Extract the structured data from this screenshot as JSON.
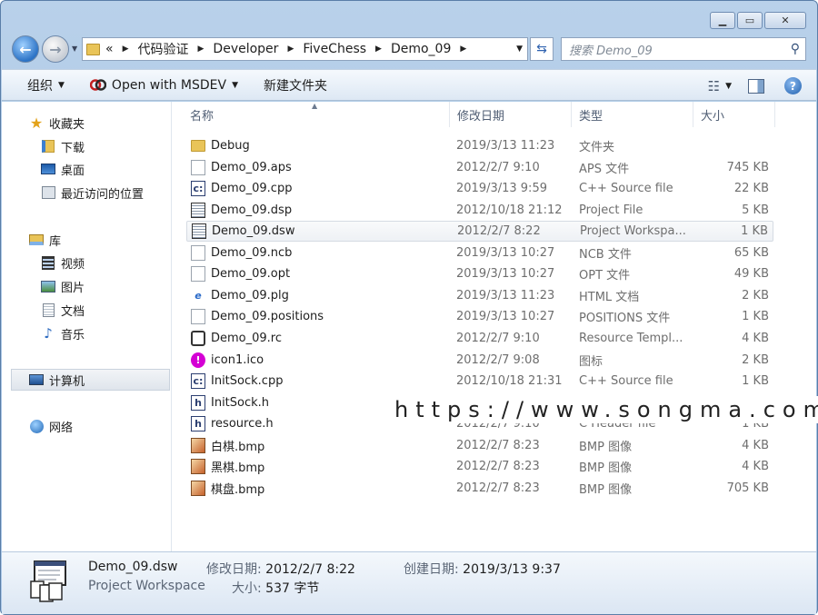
{
  "address": {
    "crumbs": [
      "«",
      "代码验证",
      "Developer",
      "FiveChess",
      "Demo_09"
    ],
    "search_placeholder": "搜索 Demo_09"
  },
  "toolbar": {
    "organize": "组织",
    "open_with": "Open with MSDEV",
    "new_folder": "新建文件夹"
  },
  "nav": {
    "favorites": "收藏夹",
    "downloads": "下载",
    "desktop": "桌面",
    "recent": "最近访问的位置",
    "libraries": "库",
    "videos": "视频",
    "pictures": "图片",
    "documents": "文档",
    "music": "音乐",
    "computer": "计算机",
    "network": "网络"
  },
  "columns": {
    "name": "名称",
    "date": "修改日期",
    "type": "类型",
    "size": "大小"
  },
  "files": [
    {
      "name": "Debug",
      "date": "2019/3/13 11:23",
      "type": "文件夹",
      "size": "",
      "icon": "folder-icon"
    },
    {
      "name": "Demo_09.aps",
      "date": "2012/2/7 9:10",
      "type": "APS 文件",
      "size": "745 KB",
      "icon": "file-icon"
    },
    {
      "name": "Demo_09.cpp",
      "date": "2019/3/13 9:59",
      "type": "C++ Source file",
      "size": "22 KB",
      "icon": "cpp-file-icon"
    },
    {
      "name": "Demo_09.dsp",
      "date": "2012/10/18 21:12",
      "type": "Project File",
      "size": "5 KB",
      "icon": "project-file-icon"
    },
    {
      "name": "Demo_09.dsw",
      "date": "2012/2/7 8:22",
      "type": "Project Workspa...",
      "size": "1 KB",
      "icon": "workspace-file-icon"
    },
    {
      "name": "Demo_09.ncb",
      "date": "2019/3/13 10:27",
      "type": "NCB 文件",
      "size": "65 KB",
      "icon": "file-icon"
    },
    {
      "name": "Demo_09.opt",
      "date": "2019/3/13 10:27",
      "type": "OPT 文件",
      "size": "49 KB",
      "icon": "file-icon"
    },
    {
      "name": "Demo_09.plg",
      "date": "2019/3/13 11:23",
      "type": "HTML 文档",
      "size": "2 KB",
      "icon": "html-file-icon"
    },
    {
      "name": "Demo_09.positions",
      "date": "2019/3/13 10:27",
      "type": "POSITIONS 文件",
      "size": "1 KB",
      "icon": "file-icon"
    },
    {
      "name": "Demo_09.rc",
      "date": "2012/2/7 9:10",
      "type": "Resource Templ...",
      "size": "4 KB",
      "icon": "resource-file-icon"
    },
    {
      "name": "icon1.ico",
      "date": "2012/2/7 9:08",
      "type": "图标",
      "size": "2 KB",
      "icon": "ico-file-icon"
    },
    {
      "name": "InitSock.cpp",
      "date": "2012/10/18 21:31",
      "type": "C++ Source file",
      "size": "1 KB",
      "icon": "cpp-file-icon"
    },
    {
      "name": "InitSock.h",
      "date": "2012/10/18 21:32",
      "type": "C Header file",
      "size": "1 KB",
      "icon": "header-file-icon"
    },
    {
      "name": "resource.h",
      "date": "2012/2/7 9:10",
      "type": "C Header file",
      "size": "1 KB",
      "icon": "header-file-icon"
    },
    {
      "name": "白棋.bmp",
      "date": "2012/2/7 8:23",
      "type": "BMP 图像",
      "size": "4 KB",
      "icon": "bmp-file-icon"
    },
    {
      "name": "黑棋.bmp",
      "date": "2012/2/7 8:23",
      "type": "BMP 图像",
      "size": "4 KB",
      "icon": "bmp-file-icon"
    },
    {
      "name": "棋盘.bmp",
      "date": "2012/2/7 8:23",
      "type": "BMP 图像",
      "size": "705 KB",
      "icon": "bmp-file-icon"
    }
  ],
  "watermark": "https://www.songma.com",
  "details": {
    "name": "Demo_09.dsw",
    "type": "Project Workspace",
    "modified_label": "修改日期:",
    "modified_value": "2012/2/7 8:22",
    "size_label": "大小:",
    "size_value": "537 字节",
    "created_label": "创建日期:",
    "created_value": "2019/3/13 9:37"
  }
}
